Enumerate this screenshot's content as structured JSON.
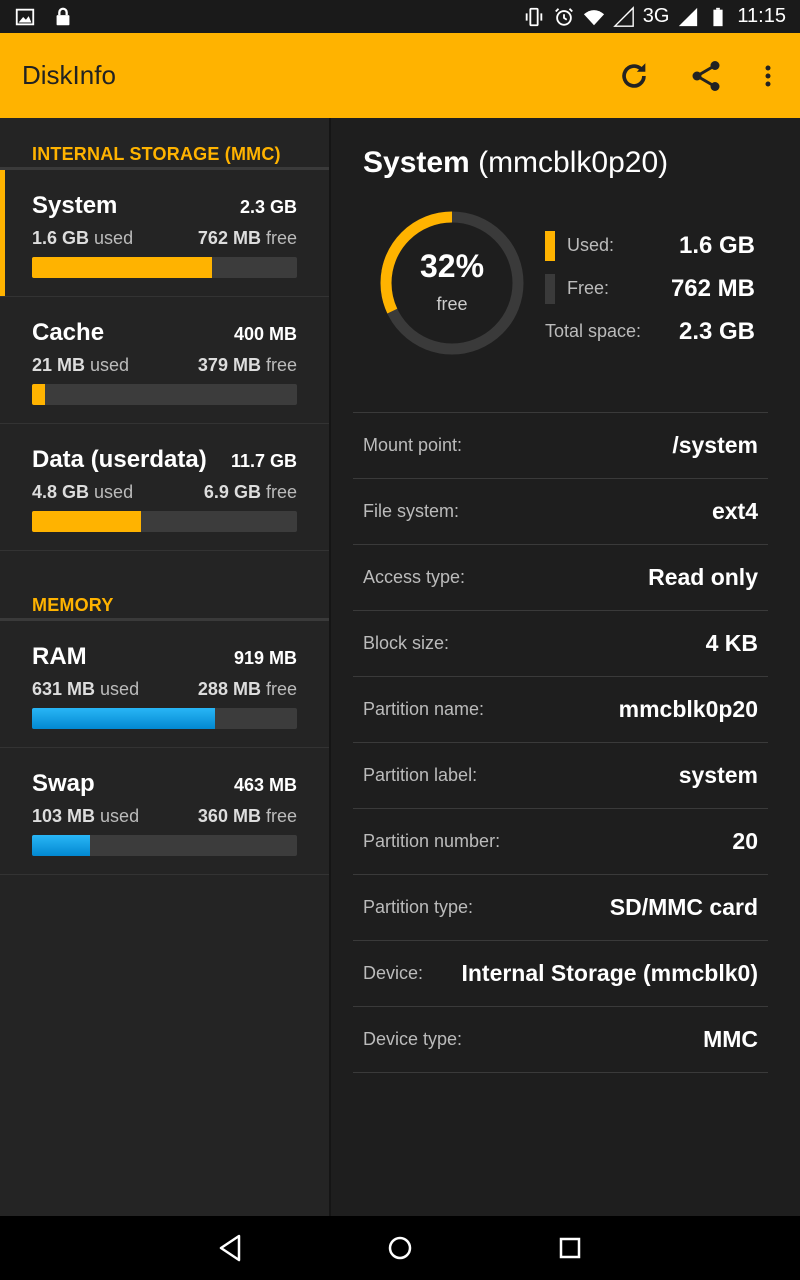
{
  "status_bar": {
    "network": "3G",
    "time": "11:15"
  },
  "app_bar": {
    "title": "DiskInfo",
    "icons": [
      "refresh-icon",
      "share-icon",
      "more-vert-icon"
    ]
  },
  "colors": {
    "accent": "#ffb300",
    "memory_bar": "#29b6f6",
    "bar_track": "#3c3c3c"
  },
  "sections": {
    "storage_header": "INTERNAL STORAGE (MMC)",
    "memory_header": "MEMORY"
  },
  "storage_items": [
    {
      "name": "System",
      "total": "2.3 GB",
      "used_num": "1.6 GB",
      "used_word": "used",
      "free_num": "762 MB",
      "free_word": "free",
      "used_fraction": 0.68
    },
    {
      "name": "Cache",
      "total": "400 MB",
      "used_num": "21 MB",
      "used_word": "used",
      "free_num": "379 MB",
      "free_word": "free",
      "used_fraction": 0.05
    },
    {
      "name": "Data (userdata)",
      "total": "11.7 GB",
      "used_num": "4.8 GB",
      "used_word": "used",
      "free_num": "6.9 GB",
      "free_word": "free",
      "used_fraction": 0.41
    }
  ],
  "memory_items": [
    {
      "name": "RAM",
      "total": "919 MB",
      "used_num": "631 MB",
      "used_word": "used",
      "free_num": "288 MB",
      "free_word": "free",
      "used_fraction": 0.69
    },
    {
      "name": "Swap",
      "total": "463 MB",
      "used_num": "103 MB",
      "used_word": "used",
      "free_num": "360 MB",
      "free_word": "free",
      "used_fraction": 0.22
    }
  ],
  "detail": {
    "title_bold": "System",
    "title_rest": "(mmcblk0p20)",
    "percent_free": "32%",
    "free_word": "free",
    "free_fraction": 0.32,
    "legend": {
      "used_label": "Used:",
      "used_value": "1.6 GB",
      "free_label": "Free:",
      "free_value": "762 MB",
      "total_label": "Total space:",
      "total_value": "2.3 GB"
    },
    "properties": [
      {
        "label": "Mount point:",
        "value": "/system"
      },
      {
        "label": "File system:",
        "value": "ext4"
      },
      {
        "label": "Access type:",
        "value": "Read only"
      },
      {
        "label": "Block size:",
        "value": "4 KB"
      },
      {
        "label": "Partition name:",
        "value": "mmcblk0p20"
      },
      {
        "label": "Partition label:",
        "value": "system"
      },
      {
        "label": "Partition number:",
        "value": "20"
      },
      {
        "label": "Partition type:",
        "value": "SD/MMC card"
      },
      {
        "label": "Device:",
        "value": "Internal Storage (mmcblk0)"
      },
      {
        "label": "Device type:",
        "value": "MMC"
      }
    ]
  },
  "nav_bar": {
    "icons": [
      "back-icon",
      "home-icon",
      "recents-icon"
    ]
  }
}
